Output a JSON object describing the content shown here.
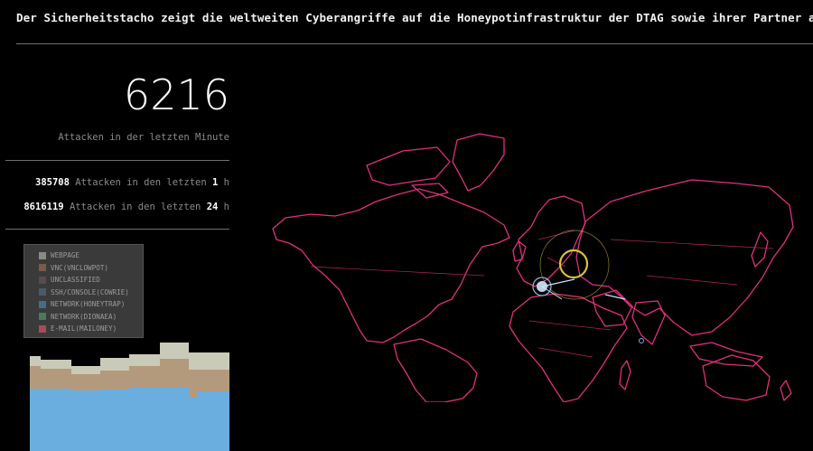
{
  "header": {
    "text": "Der Sicherheitstacho zeigt die weltweiten Cyberangriffe auf die Honeypotinfrastruktur der DTAG sowie ihrer Partner an."
  },
  "minute": {
    "count": "6216",
    "label": "Attacken in der letzten Minute"
  },
  "hour": {
    "count": "385708",
    "text": "Attacken in den letzten",
    "n": "1",
    "unit": "h"
  },
  "day": {
    "count": "8616119",
    "text": "Attacken in den letzten",
    "n": "24",
    "unit": "h"
  },
  "legend": {
    "items": [
      {
        "label": "WEBPAGE",
        "color": "#8a8a84"
      },
      {
        "label": "VNC(VNCLOWPOT)",
        "color": "#7a5a48"
      },
      {
        "label": "UNCLASSIFIED",
        "color": "#5a4a52"
      },
      {
        "label": "SSH/CONSOLE(COWRIE)",
        "color": "#4a5a6a"
      },
      {
        "label": "NETWORK(HONEYTRAP)",
        "color": "#3f6f8a"
      },
      {
        "label": "NETWORK(DIONAEA)",
        "color": "#4a7a5a"
      },
      {
        "label": "E-MAIL(MAILONEY)",
        "color": "#a84a5a"
      }
    ]
  },
  "colors": {
    "map_stroke": "#e0307a",
    "area_blue": "#6aaee0",
    "area_brown": "#b39a7c",
    "area_gray": "#c9cbb8",
    "ring": "#d8c040"
  }
}
